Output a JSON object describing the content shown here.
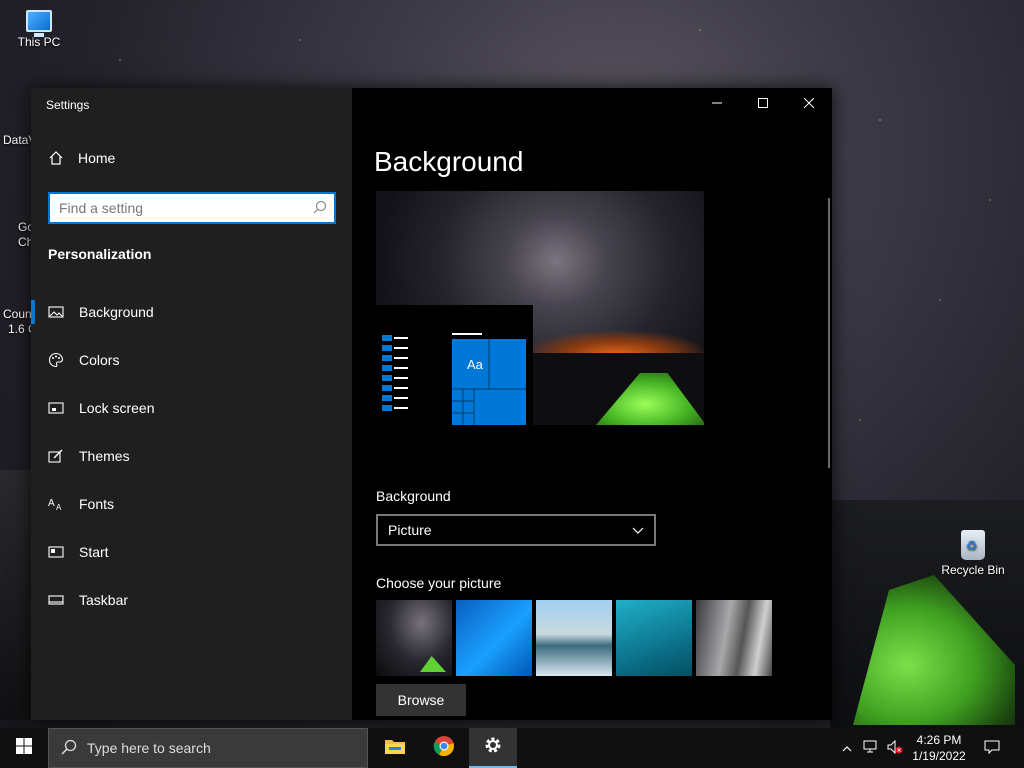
{
  "desktop": {
    "icons": [
      {
        "label": "This PC",
        "icon": "computer-icon"
      },
      {
        "label": "Recycle Bin",
        "icon": "recycle-bin-icon"
      }
    ],
    "partial_labels": [
      "DataV",
      "Go",
      "Ch",
      "Coun",
      "1.6 C"
    ]
  },
  "window": {
    "title": "Settings",
    "controls": [
      "minimize-icon",
      "maximize-icon",
      "close-icon"
    ]
  },
  "nav": {
    "home_label": "Home",
    "search_placeholder": "Find a setting",
    "section_title": "Personalization",
    "items": [
      {
        "label": "Background",
        "icon": "picture-icon",
        "active": true
      },
      {
        "label": "Colors",
        "icon": "palette-icon",
        "active": false
      },
      {
        "label": "Lock screen",
        "icon": "lock-screen-icon",
        "active": false
      },
      {
        "label": "Themes",
        "icon": "themes-icon",
        "active": false
      },
      {
        "label": "Fonts",
        "icon": "fonts-icon",
        "active": false
      },
      {
        "label": "Start",
        "icon": "start-icon",
        "active": false
      },
      {
        "label": "Taskbar",
        "icon": "taskbar-icon",
        "active": false
      }
    ]
  },
  "content": {
    "page_title": "Background",
    "preview_tile_text": "Aa",
    "background_label": "Background",
    "background_value": "Picture",
    "choose_label": "Choose your picture",
    "browse_label": "Browse"
  },
  "taskbar": {
    "search_placeholder": "Type here to search",
    "apps": [
      "file-explorer-icon",
      "chrome-icon",
      "settings-icon"
    ],
    "time": "4:26 PM",
    "date": "1/19/2022"
  },
  "colors": {
    "accent": "#0078d7",
    "nav_bg": "#1f1f1f",
    "content_bg": "#000000"
  }
}
